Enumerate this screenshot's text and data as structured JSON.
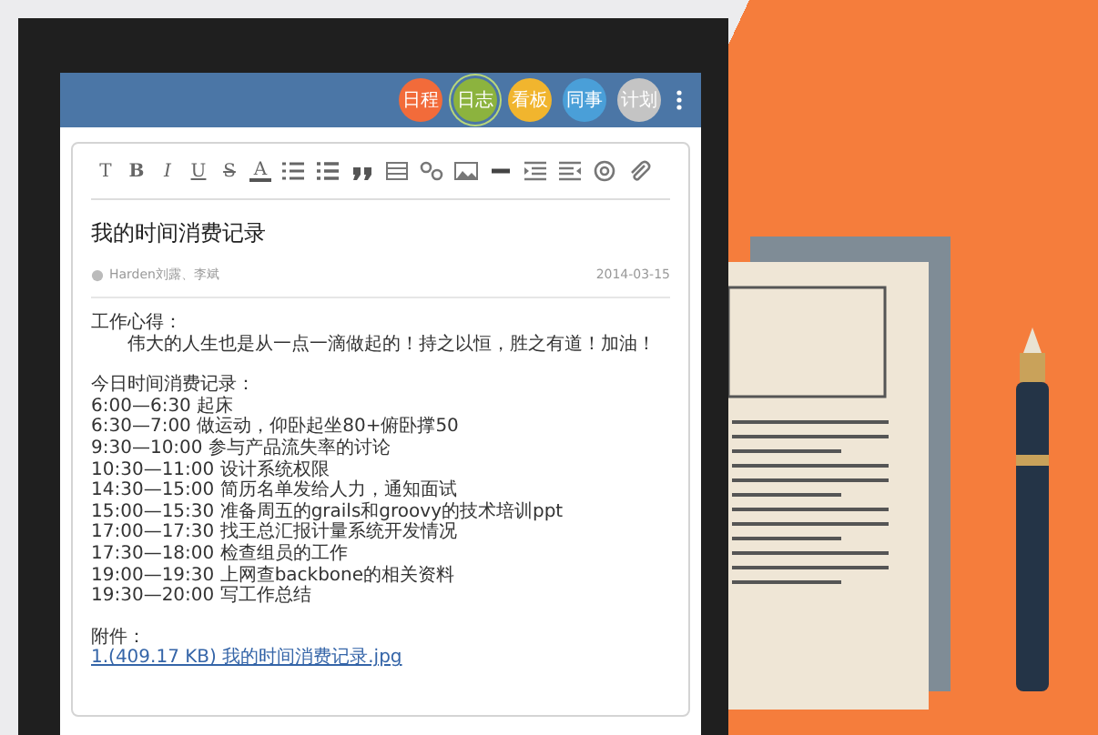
{
  "header": {
    "tabs": [
      {
        "label": "日程",
        "color": "#f26b3a",
        "selected": false
      },
      {
        "label": "日志",
        "color": "#8cb33e",
        "selected": true
      },
      {
        "label": "看板",
        "color": "#f1b52e",
        "selected": false
      },
      {
        "label": "同事",
        "color": "#4a9fd8",
        "selected": false
      },
      {
        "label": "计划",
        "color": "#c4c4c4",
        "selected": false
      }
    ]
  },
  "toolbar": {
    "letters": [
      {
        "label": "T",
        "kind": "plain"
      },
      {
        "label": "B",
        "kind": "bold"
      },
      {
        "label": "I",
        "kind": "italic"
      },
      {
        "label": "U",
        "kind": "underline"
      },
      {
        "label": "S",
        "kind": "strike"
      },
      {
        "label": "A",
        "kind": "color"
      }
    ]
  },
  "note": {
    "title": "我的时间消费记录",
    "author": "Harden刘露、李斌",
    "date": "2014-03-15",
    "sections": [
      {
        "heading": "工作心得：",
        "indent": true,
        "lines": [
          "伟大的人生也是从一点一滴做起的！持之以恒，胜之有道！加油！"
        ]
      },
      {
        "heading": "今日时间消费记录：",
        "indent": false,
        "lines": [
          "6:00—6:30  起床",
          "6:30—7:00  做运动，仰卧起坐80+俯卧撑50",
          "9:30—10:00  参与产品流失率的讨论",
          "10:30—11:00  设计系统权限",
          "14:30—15:00  简历名单发给人力，通知面试",
          "15:00—15:30  准备周五的grails和groovy的技术培训ppt",
          "17:00—17:30  找王总汇报计量系统开发情况",
          "17:30—18:00  检查组员的工作",
          "19:00—19:30  上网查backbone的相关资料",
          "19:30—20:00  写工作总结"
        ]
      },
      {
        "heading": "附件：",
        "indent": false,
        "links": [
          "1.(409.17 KB)  我的时间消费记录.jpg"
        ]
      }
    ]
  }
}
